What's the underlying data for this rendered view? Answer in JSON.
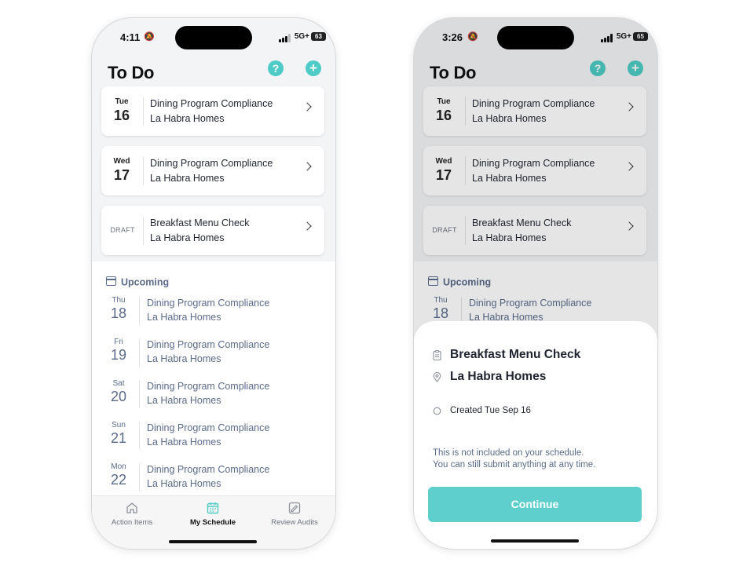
{
  "left_screen": {
    "status": {
      "time": "4:11",
      "network": "5G+",
      "battery": "63"
    },
    "header": {
      "title": "To Do",
      "help_icon": "help-icon",
      "add_icon": "plus-icon"
    },
    "todo_cards": [
      {
        "weekday": "Tue",
        "day": "16",
        "title": "Dining Program Compliance",
        "location": "La Habra Homes"
      },
      {
        "weekday": "Wed",
        "day": "17",
        "title": "Dining Program Compliance",
        "location": "La Habra Homes"
      },
      {
        "badge": "DRAFT",
        "title": "Breakfast Menu Check",
        "location": "La Habra Homes"
      }
    ],
    "upcoming": {
      "heading": "Upcoming",
      "items": [
        {
          "weekday": "Thu",
          "day": "18",
          "title": "Dining Program Compliance",
          "location": "La Habra Homes"
        },
        {
          "weekday": "Fri",
          "day": "19",
          "title": "Dining Program Compliance",
          "location": "La Habra Homes"
        },
        {
          "weekday": "Sat",
          "day": "20",
          "title": "Dining Program Compliance",
          "location": "La Habra Homes"
        },
        {
          "weekday": "Sun",
          "day": "21",
          "title": "Dining Program Compliance",
          "location": "La Habra Homes"
        },
        {
          "weekday": "Mon",
          "day": "22",
          "title": "Dining Program Compliance",
          "location": "La Habra Homes"
        }
      ]
    },
    "tabs": [
      {
        "label": "Action Items",
        "icon": "home-icon",
        "active": false
      },
      {
        "label": "My Schedule",
        "icon": "calendar-icon",
        "active": true
      },
      {
        "label": "Review Audits",
        "icon": "review-icon",
        "active": false
      }
    ]
  },
  "right_screen": {
    "status": {
      "time": "3:26",
      "network": "5G+",
      "battery": "65"
    },
    "header": {
      "title": "To Do"
    },
    "todo_cards": [
      {
        "weekday": "Tue",
        "day": "16",
        "title": "Dining Program Compliance",
        "location": "La Habra Homes"
      },
      {
        "weekday": "Wed",
        "day": "17",
        "title": "Dining Program Compliance",
        "location": "La Habra Homes"
      },
      {
        "badge": "DRAFT",
        "title": "Breakfast Menu Check",
        "location": "La Habra Homes"
      }
    ],
    "upcoming": {
      "heading": "Upcoming",
      "items": [
        {
          "weekday": "Thu",
          "day": "18",
          "title": "Dining Program Compliance",
          "location": "La Habra Homes"
        }
      ]
    },
    "sheet": {
      "title": "Breakfast Menu Check",
      "location": "La Habra Homes",
      "created": "Created Tue Sep 16",
      "note_line1": "This is not included on your schedule.",
      "note_line2": "You can still submit anything at any time.",
      "continue_label": "Continue"
    }
  },
  "colors": {
    "accent": "#4ecbc6",
    "button": "#5ecfcd",
    "muted_text": "#5b6b8c"
  }
}
